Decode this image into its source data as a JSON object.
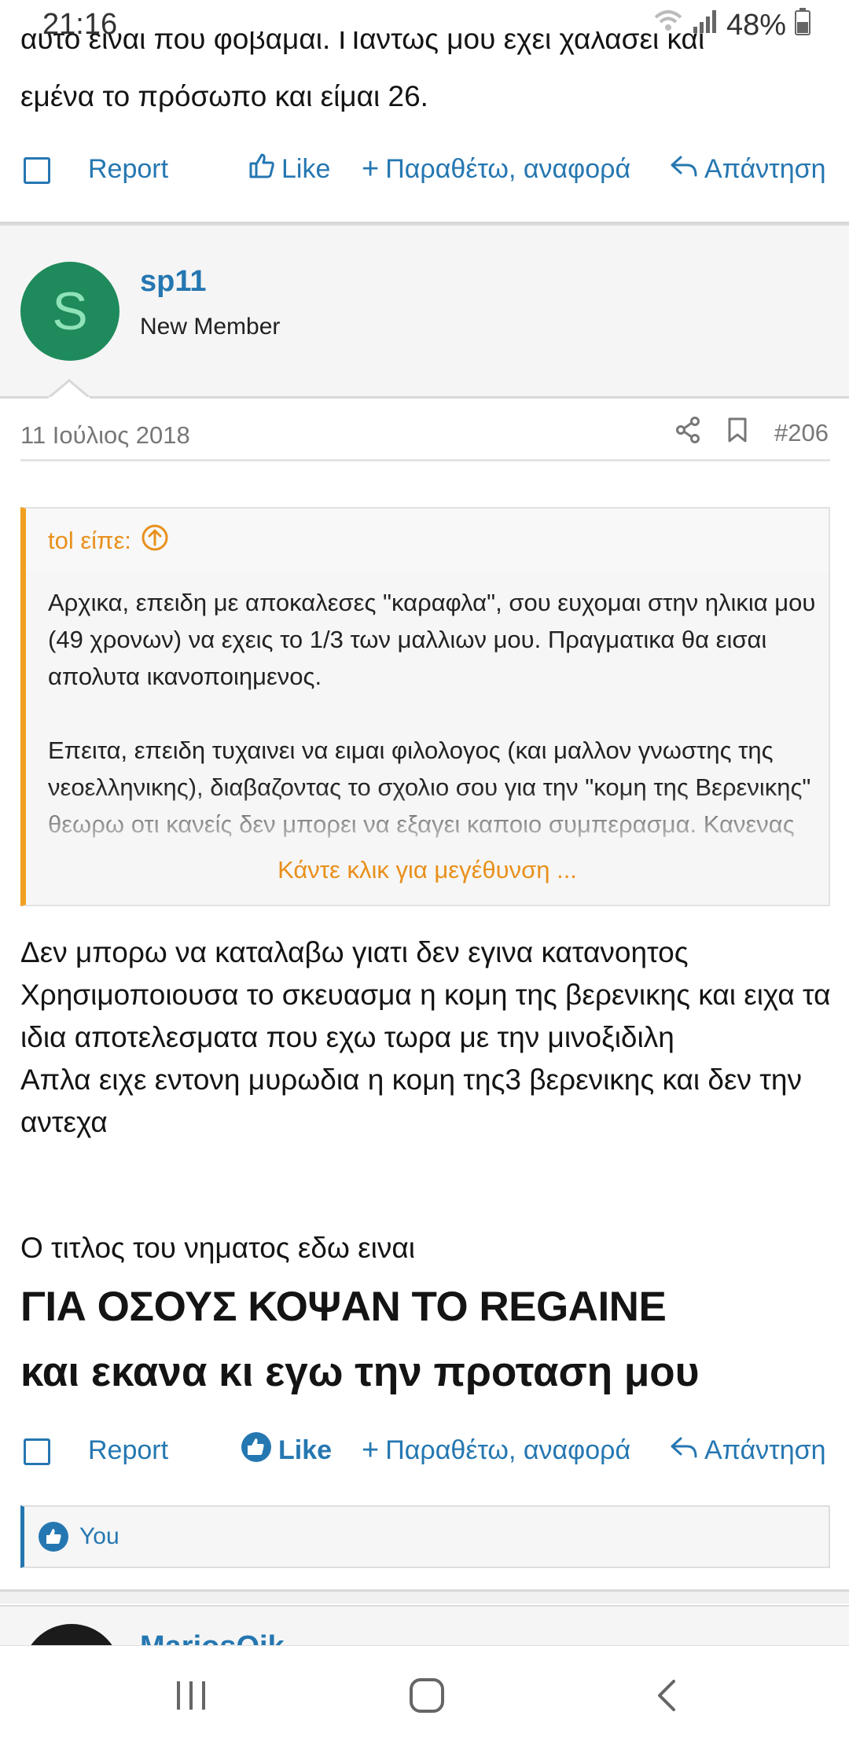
{
  "status_bar": {
    "time": "21:16",
    "battery": "48%"
  },
  "previous_post": {
    "text_partial_line": "αυτο ειναι που φοβαμαι. Παντως μου εχει χαλασει και",
    "text_line2": "εμένα το πρόσωπο και είμαι 26.",
    "actions": {
      "report": "Report",
      "like": "Like",
      "quote": "Παραθέτω, αναφορά",
      "reply": "Απάντηση"
    }
  },
  "post": {
    "user": {
      "avatar_letter": "S",
      "name": "sp11",
      "title": "New Member"
    },
    "date": "11 Ιούλιος 2018",
    "number": "#206",
    "quote": {
      "author": "tol είπε:",
      "paragraph1": "Αρχικα, επειδη με αποκαλεσες \"καραφλα\", σου ευχομαι στην ηλικια μου (49 χρονων) να εχεις το 1/3 των μαλλιων μου. Πραγματικα θα εισαι απολυτα ικανοποιημενος.",
      "paragraph2": "Επειτα, επειδη τυχαινει να ειμαι φιλολογος (και μαλλον γνωστης της νεοελληνικης), διαβαζοντας το σχολιο σου για την \"κομη της Βερενικης\" θεωρω οτι κανείς δεν μπορει να εξαγει καποιο συμπερασμα. Κανενας ειρμος στη σκεψη σου,",
      "expand_label": "Κάντε κλικ για μεγέθυνση ..."
    },
    "body": [
      "Δεν μπορω να καταλαβω γιατι δεν εγινα κατανοητος",
      "Χρησιμοποιουσα το σκευασμα η κομη της βερενικης και ειχα τα ιδια αποτελεσματα που εχω τωρα με την μινοξιδιλη",
      "Απλα ειχε εντονη μυρωδια η κομη της3 βερενικης και δεν την αντεχα"
    ],
    "title_intro": "Ο τιτλος του νηματος εδω ειναι",
    "thread_title": "ΓΙΑ ΟΣΟΥΣ ΚΟΨΑΝ ΤΟ REGAINE",
    "closing": "και εκανα κι εγω την προταση μου",
    "actions": {
      "report": "Report",
      "like": "Like",
      "quote": "Παραθέτω, αναφορά",
      "reply": "Απάντηση"
    },
    "likes_by": "You"
  },
  "next_post": {
    "name": "MariosOik"
  },
  "colors": {
    "link": "#2577b1",
    "quote_accent": "#f0a020",
    "avatar_bg": "#1f8a5b"
  }
}
